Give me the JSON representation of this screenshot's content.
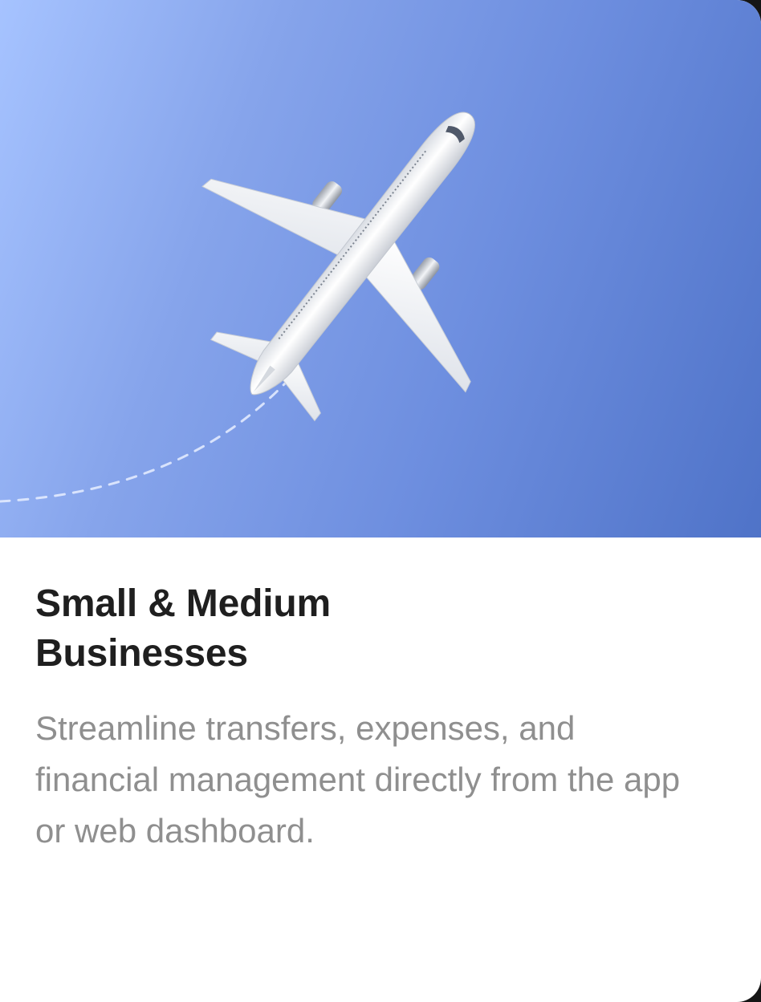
{
  "card": {
    "image": {
      "icon": "airplane-icon",
      "trail": "dashed-flight-path"
    },
    "title": "Small & Medium\nBusinesses",
    "description": "Streamline transfers, expenses, and financial management directly from the app or web dashboard."
  },
  "colors": {
    "hero_gradient_start": "#a6c3ff",
    "hero_gradient_end": "#4f73c8",
    "title": "#1f1f1f",
    "description": "#8f8f8f"
  }
}
